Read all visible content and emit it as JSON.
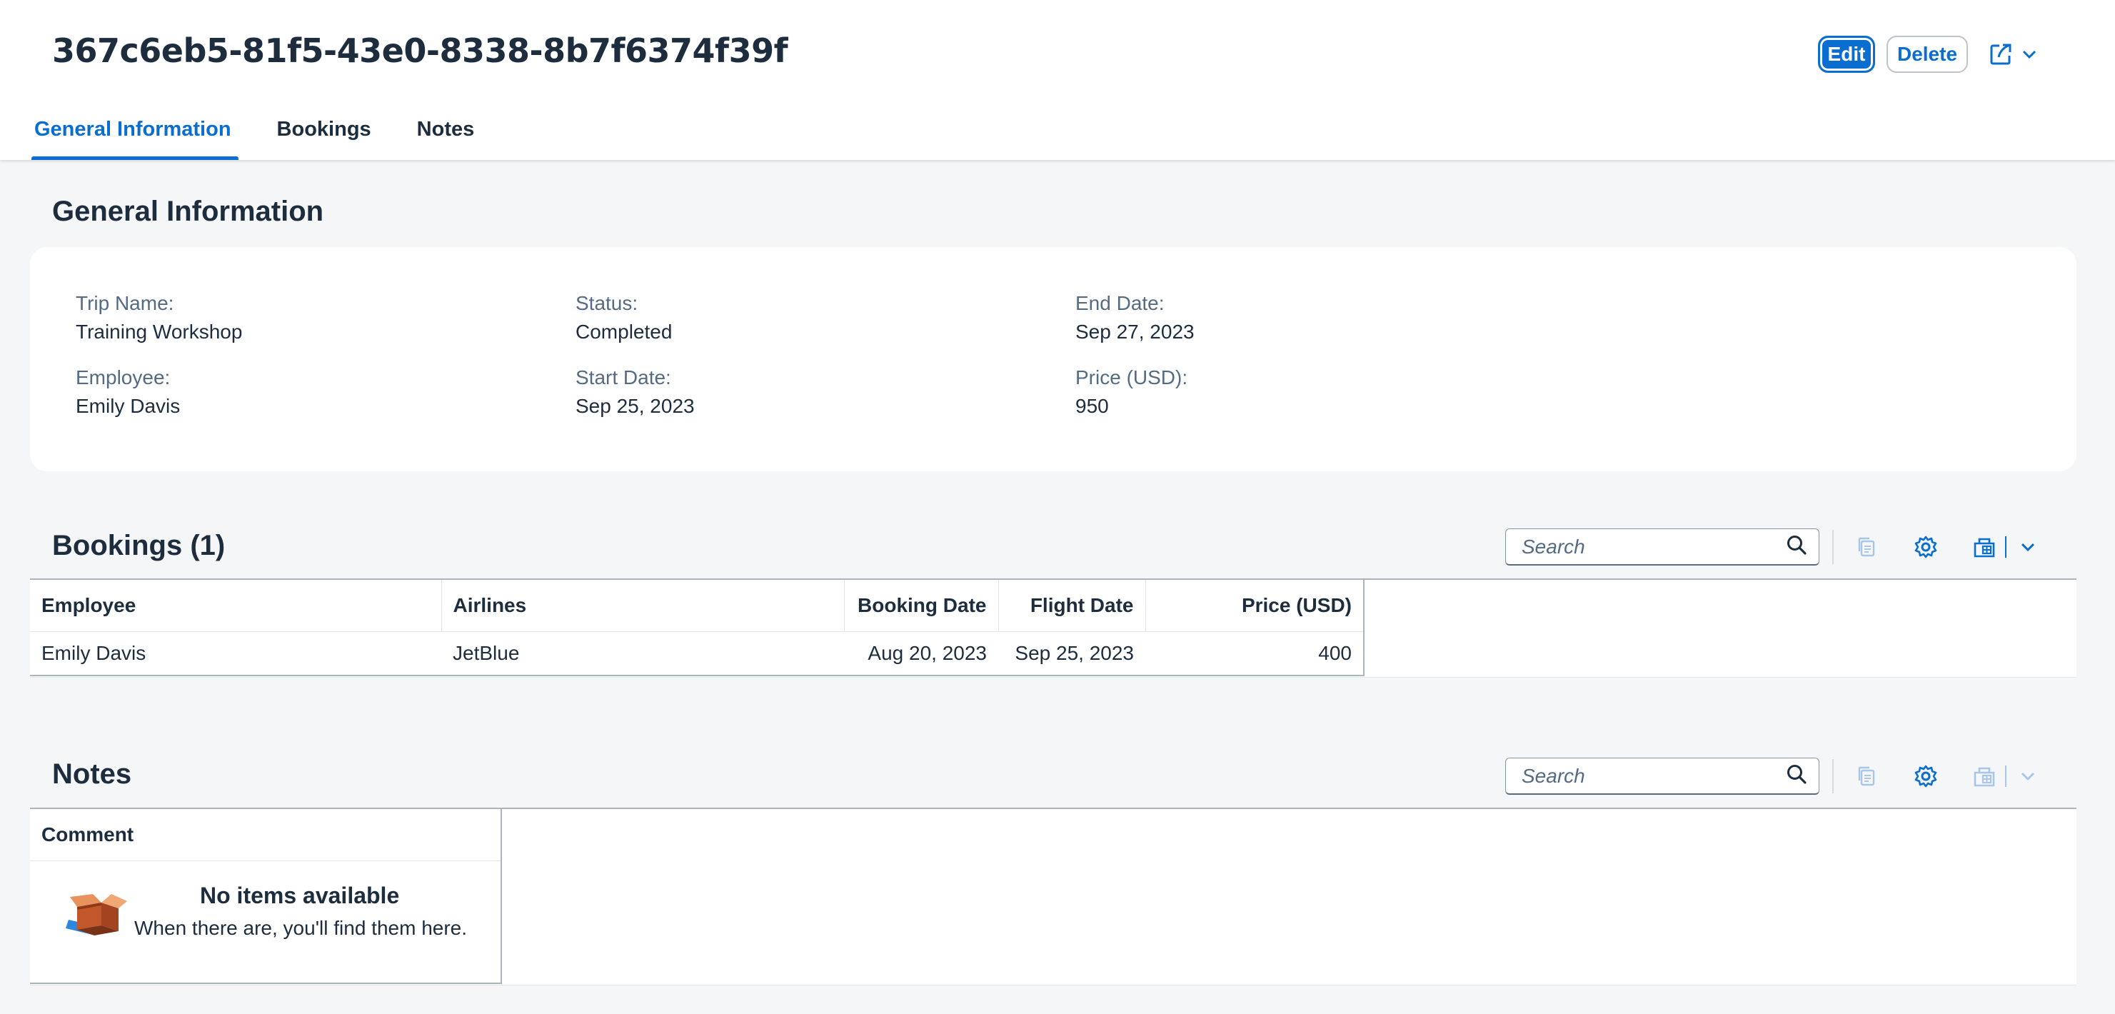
{
  "header": {
    "title": "367c6eb5-81f5-43e0-8338-8b7f6374f39f",
    "edit_label": "Edit",
    "delete_label": "Delete",
    "share_icon": "share-icon",
    "tabs": [
      {
        "label": "General Information",
        "active": true
      },
      {
        "label": "Bookings",
        "active": false
      },
      {
        "label": "Notes",
        "active": false
      }
    ]
  },
  "general": {
    "section_title": "General Information",
    "fields": {
      "trip_name": {
        "label": "Trip Name:",
        "value": "Training Workshop"
      },
      "employee": {
        "label": "Employee:",
        "value": "Emily Davis"
      },
      "status": {
        "label": "Status:",
        "value": "Completed"
      },
      "start_date": {
        "label": "Start Date:",
        "value": "Sep 25, 2023"
      },
      "end_date": {
        "label": "End Date:",
        "value": "Sep 27, 2023"
      },
      "price": {
        "label": "Price (USD):",
        "value": "950"
      }
    }
  },
  "bookings": {
    "section_title": "Bookings (1)",
    "search_placeholder": "Search",
    "columns": [
      "Employee",
      "Airlines",
      "Booking Date",
      "Flight Date",
      "Price (USD)"
    ],
    "rows": [
      [
        "Emily Davis",
        "JetBlue",
        "Aug 20, 2023",
        "Sep 25, 2023",
        "400"
      ]
    ]
  },
  "notes": {
    "section_title": "Notes",
    "search_placeholder": "Search",
    "columns": [
      "Comment"
    ],
    "empty_title": "No items available",
    "empty_subtitle": "When there are, you'll find them here."
  },
  "colors": {
    "accent": "#0a6ed1",
    "page_background": "#f5f6f7",
    "text": "#1d2d3e",
    "label": "#556b82"
  }
}
